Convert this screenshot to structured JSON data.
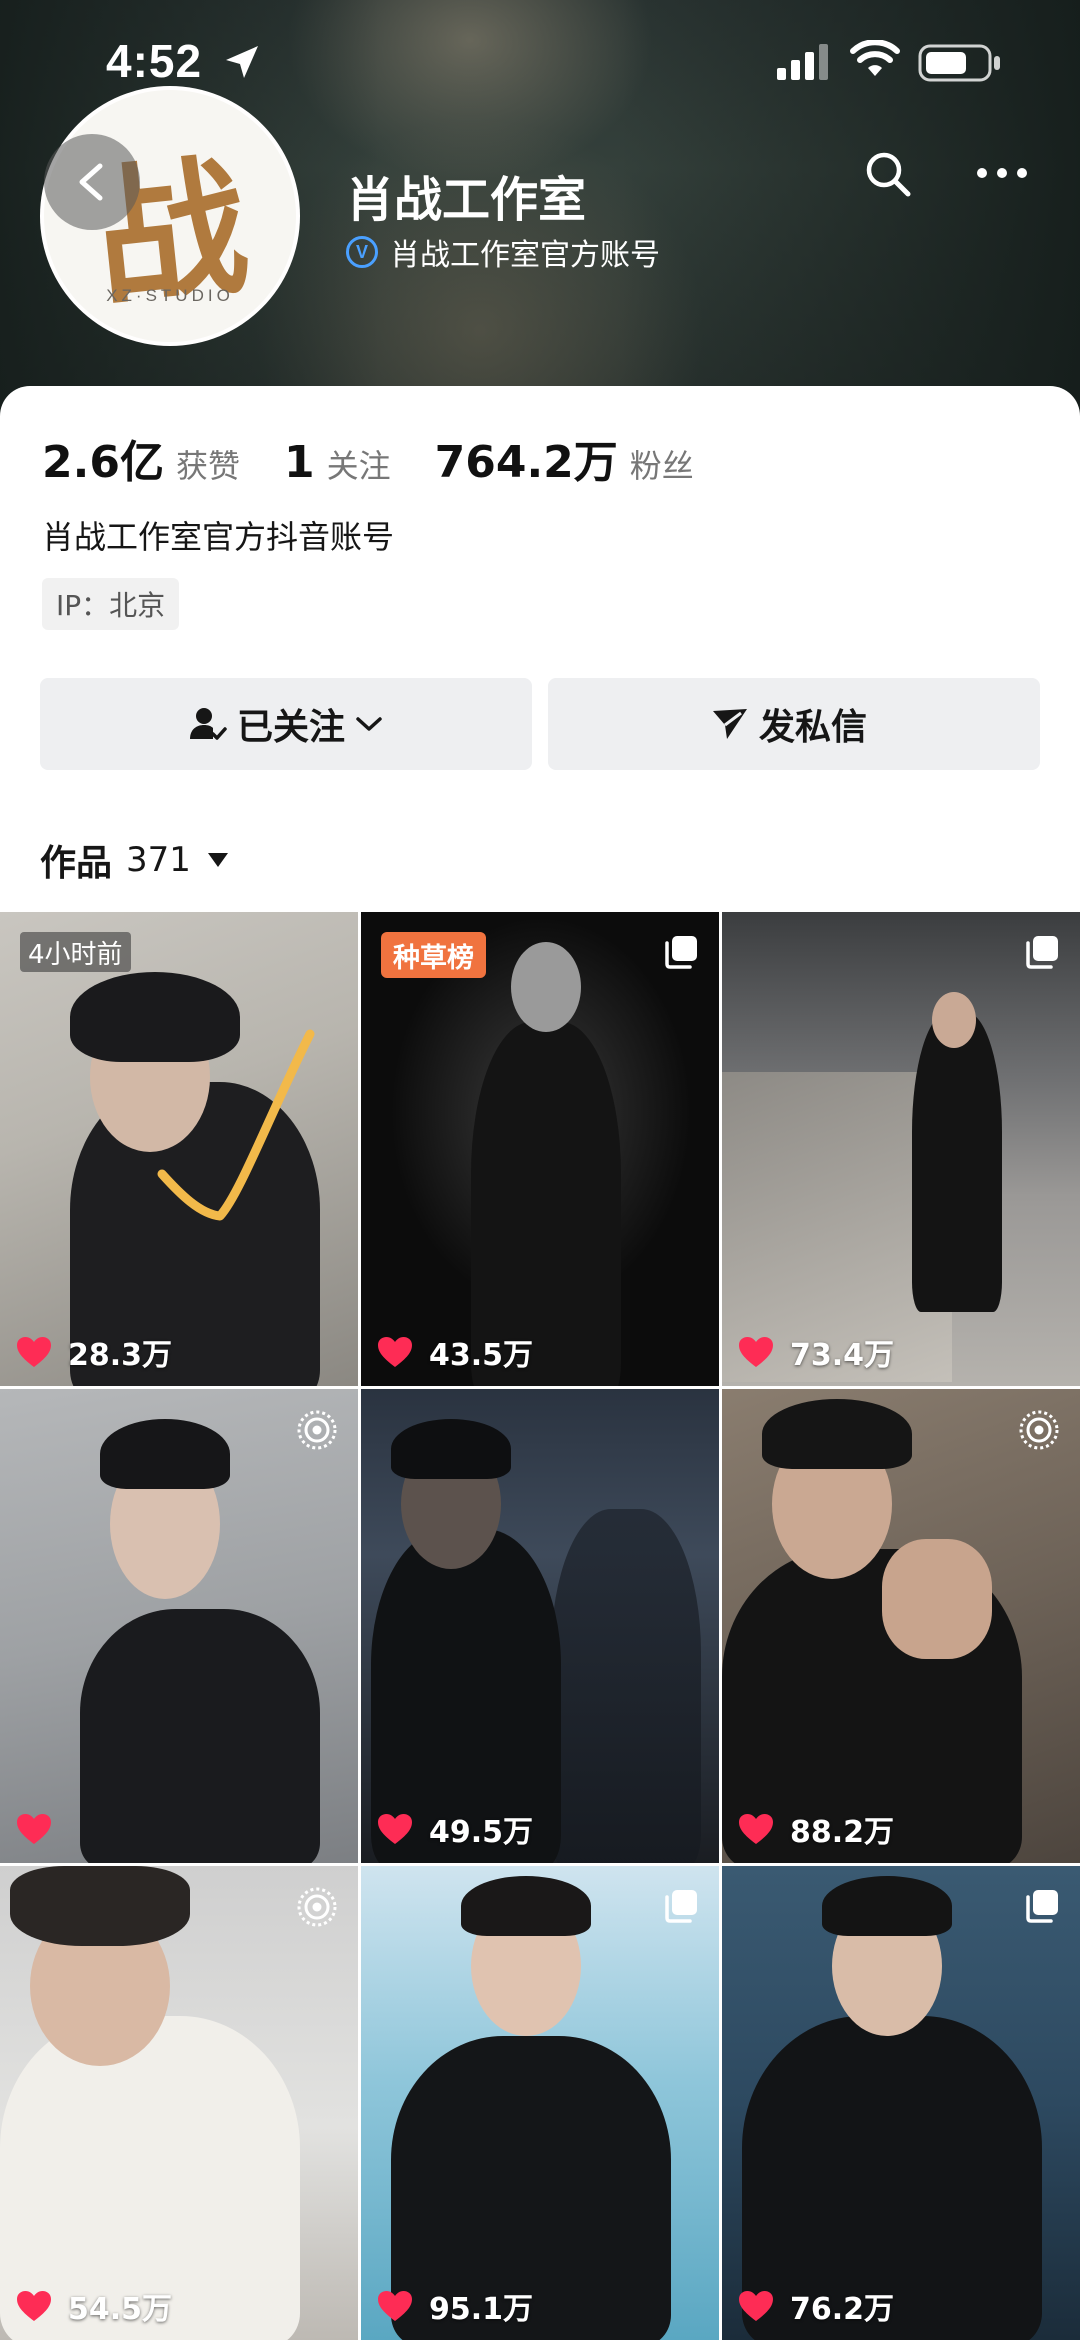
{
  "status_bar": {
    "time": "4:52"
  },
  "profile": {
    "name": "肖战工作室",
    "verified_text": "肖战工作室官方账号",
    "avatar_glyph": "战",
    "avatar_caption": "XZ·STUDIO",
    "verified_mark": "V"
  },
  "stats": {
    "likes_value": "2.6亿",
    "likes_label": "获赞",
    "following_value": "1",
    "following_label": "关注",
    "followers_value": "764.2万",
    "followers_label": "粉丝"
  },
  "bio": "肖战工作室官方抖音账号",
  "ip_tag": "IP：北京",
  "actions": {
    "followed_label": "已关注",
    "message_label": "发私信"
  },
  "works": {
    "label": "作品",
    "count": "371"
  },
  "videos": [
    {
      "likes": "28.3万",
      "badge": "4小时前"
    },
    {
      "likes": "43.5万",
      "badge": "种草榜"
    },
    {
      "likes": "73.4万"
    },
    {
      "likes": ""
    },
    {
      "likes": "49.5万"
    },
    {
      "likes": "88.2万"
    },
    {
      "likes": "54.5万"
    },
    {
      "likes": "95.1万"
    },
    {
      "likes": "76.2万"
    }
  ],
  "colors": {
    "accent_heart": "#fe2c55",
    "rank_badge": "#f0733f",
    "verified": "#4aa0ff"
  }
}
